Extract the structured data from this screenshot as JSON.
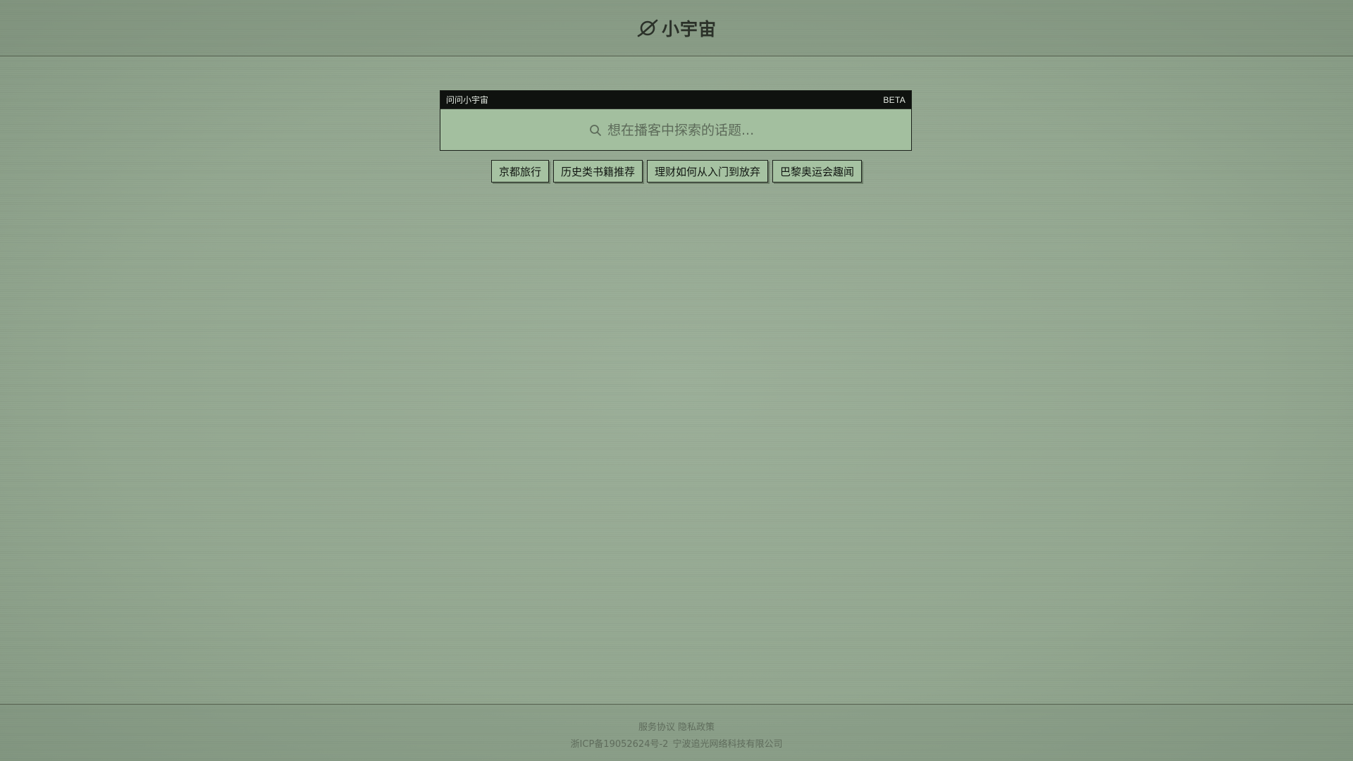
{
  "header": {
    "logo_icon": "planet-icon",
    "logo_text": "小宇宙"
  },
  "ask_panel": {
    "title": "问问小宇宙",
    "badge": "BETA",
    "search_icon": "search-icon",
    "placeholder": "想在播客中探索的话题..."
  },
  "suggestions": [
    {
      "label": "京都旅行"
    },
    {
      "label": "历史类书籍推荐"
    },
    {
      "label": "理财如何从入门到放弃"
    },
    {
      "label": "巴黎奥运会趣闻"
    }
  ],
  "footer": {
    "terms": "服务协议",
    "privacy": "隐私政策",
    "icp": "浙ICP备19052624号-2",
    "company": "宁波追光网络科技有限公司"
  },
  "colors": {
    "background": "#97aa93",
    "titlebar": "#0f120f",
    "chip": "#a6c2a2"
  }
}
